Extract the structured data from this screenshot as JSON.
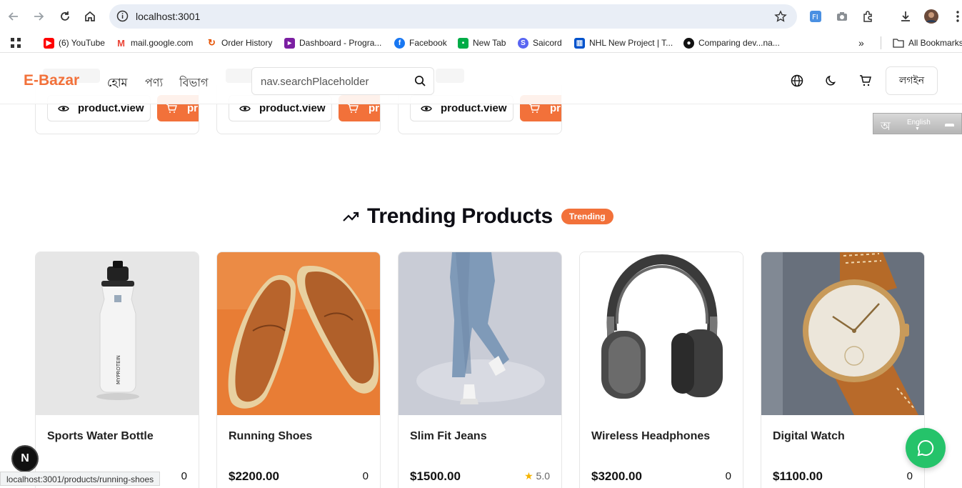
{
  "browser": {
    "url": "localhost:3001",
    "status_url": "localhost:3001/products/running-shoes",
    "bookmarks": [
      {
        "label": "(6) YouTube",
        "icon": "youtube-icon",
        "color": "#ff0000"
      },
      {
        "label": "mail.google.com",
        "icon": "gmail-icon",
        "color": "#ea4335"
      },
      {
        "label": "Order History",
        "icon": "order-icon",
        "color": "#e65100"
      },
      {
        "label": "Dashboard - Progra...",
        "icon": "dashboard-icon",
        "color": "#7b1fa2"
      },
      {
        "label": "Facebook",
        "icon": "facebook-icon",
        "color": "#1877f2"
      },
      {
        "label": "New Tab",
        "icon": "meet-icon",
        "color": "#00ac47"
      },
      {
        "label": "Saicord",
        "icon": "saicord-icon",
        "color": "#5865f2"
      },
      {
        "label": "NHL New Project | T...",
        "icon": "trello-icon",
        "color": "#0052cc"
      },
      {
        "label": "Comparing dev...na...",
        "icon": "github-icon",
        "color": "#111111"
      }
    ],
    "more": "»",
    "all_bookmarks": "All Bookmarks"
  },
  "header": {
    "brand": "E-Bazar",
    "menu": [
      "হোম",
      "পণ্য",
      "বিভাগ"
    ],
    "search_placeholder": "nav.searchPlaceholder",
    "login": "লগইন"
  },
  "previous_row": {
    "view_label": "product.view",
    "cart_label": "pr"
  },
  "translate": {
    "bengali": "অ",
    "english": "English"
  },
  "section": {
    "title": "Trending Products",
    "badge": "Trending"
  },
  "products": [
    {
      "name": "Sports Water Bottle",
      "price": "",
      "count": "0",
      "rating": ""
    },
    {
      "name": "Running Shoes",
      "price": "$2200.00",
      "count": "0",
      "rating": ""
    },
    {
      "name": "Slim Fit Jeans",
      "price": "$1500.00",
      "count": "",
      "rating": "5.0"
    },
    {
      "name": "Wireless Headphones",
      "price": "$3200.00",
      "count": "0",
      "rating": ""
    },
    {
      "name": "Digital Watch",
      "price": "$1100.00",
      "count": "0",
      "rating": ""
    }
  ],
  "dev_badge": "N",
  "colors": {
    "accent": "#f2713a",
    "chat": "#25c36a"
  }
}
